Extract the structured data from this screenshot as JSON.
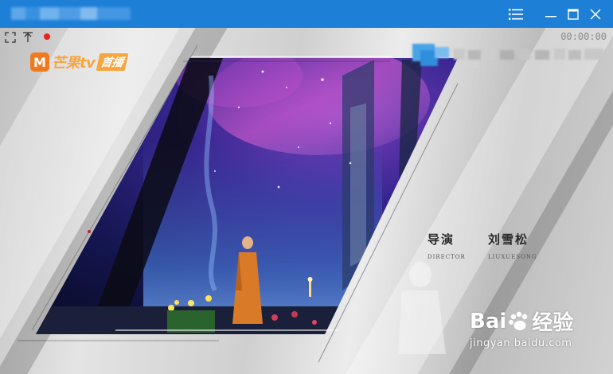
{
  "window": {
    "controls": {
      "menu_icon": "list-icon",
      "minimize_icon": "minimize-icon",
      "maximize_icon": "maximize-icon",
      "close_icon": "close-icon"
    }
  },
  "player": {
    "toolbar": {
      "fullscreen_icon": "fullscreen-icon",
      "pin_icon": "pin-top-icon",
      "record_indicator_color": "#e8231c"
    },
    "timer": "00:00:00"
  },
  "video": {
    "logo_mark": "M",
    "logo_text": "芒果tv",
    "logo_badge": "首播",
    "credits": [
      {
        "title": "导演",
        "subtitle": "DIRECTOR"
      },
      {
        "title": "刘雪松",
        "subtitle": "LIUXUESONG"
      }
    ],
    "watermark": {
      "brand_left": "Bai",
      "brand_right": "经验",
      "url": "jingyan.baidu.com"
    }
  },
  "colors": {
    "titlebar": "#1e7fd6",
    "logo_orange": "#f07a1d",
    "logo_gold": "#f7a53f",
    "record_red": "#e8231c"
  }
}
